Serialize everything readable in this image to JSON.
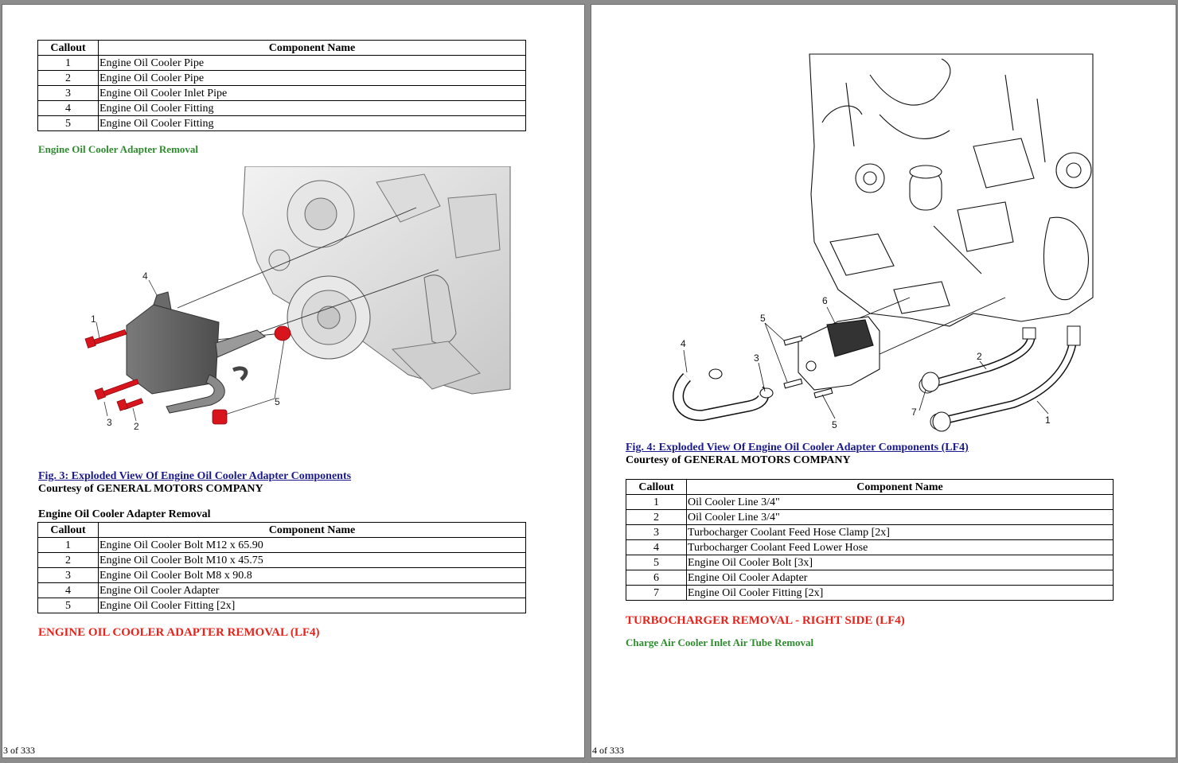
{
  "left_page": {
    "table1": {
      "headers": [
        "Callout",
        "Component Name"
      ],
      "rows": [
        [
          "1",
          "Engine Oil Cooler Pipe"
        ],
        [
          "2",
          "Engine Oil Cooler Pipe"
        ],
        [
          "3",
          "Engine Oil Cooler Inlet Pipe"
        ],
        [
          "4",
          "Engine Oil Cooler Fitting"
        ],
        [
          "5",
          "Engine Oil Cooler Fitting"
        ]
      ]
    },
    "section_heading": "Engine Oil Cooler Adapter Removal",
    "figure": {
      "callouts": [
        "1",
        "2",
        "3",
        "4",
        "5"
      ],
      "caption": "Fig. 3: Exploded View Of Engine Oil Cooler Adapter Components",
      "courtesy": "Courtesy of GENERAL MOTORS COMPANY"
    },
    "table2_title": "Engine Oil Cooler Adapter Removal",
    "table2": {
      "headers": [
        "Callout",
        "Component Name"
      ],
      "rows": [
        [
          "1",
          "Engine Oil Cooler Bolt M12 x 65.90"
        ],
        [
          "2",
          "Engine Oil Cooler Bolt M10 x 45.75"
        ],
        [
          "3",
          "Engine Oil Cooler Bolt M8 x 90.8"
        ],
        [
          "4",
          "Engine Oil Cooler Adapter"
        ],
        [
          "5",
          "Engine Oil Cooler Fitting [2x]"
        ]
      ]
    },
    "red_heading": "ENGINE OIL COOLER ADAPTER REMOVAL (LF4)",
    "page_number": "3 of 333"
  },
  "right_page": {
    "figure": {
      "callouts": [
        "1",
        "2",
        "3",
        "4",
        "5",
        "5",
        "6",
        "7"
      ],
      "caption": "Fig. 4: Exploded View Of Engine Oil Cooler Adapter Components (LF4)",
      "courtesy": "Courtesy of GENERAL MOTORS COMPANY"
    },
    "table": {
      "headers": [
        "Callout",
        "Component Name"
      ],
      "rows": [
        [
          "1",
          "Oil Cooler Line 3/4\""
        ],
        [
          "2",
          "Oil Cooler Line 3/4\""
        ],
        [
          "3",
          "Turbocharger Coolant Feed Hose Clamp [2x]"
        ],
        [
          "4",
          "Turbocharger Coolant Feed Lower Hose"
        ],
        [
          "5",
          "Engine Oil Cooler Bolt [3x]"
        ],
        [
          "6",
          "Engine Oil Cooler Adapter"
        ],
        [
          "7",
          "Engine Oil Cooler Fitting [2x]"
        ]
      ]
    },
    "red_heading": "TURBOCHARGER REMOVAL - RIGHT SIDE (LF4)",
    "green_heading": "Charge Air Cooler Inlet Air Tube Removal",
    "page_number": "4 of 333"
  },
  "colors": {
    "heading_green": "#2e8b2e",
    "heading_red": "#e8231c",
    "link_blue": "#1a1a8c",
    "part_red": "#d8141c"
  }
}
